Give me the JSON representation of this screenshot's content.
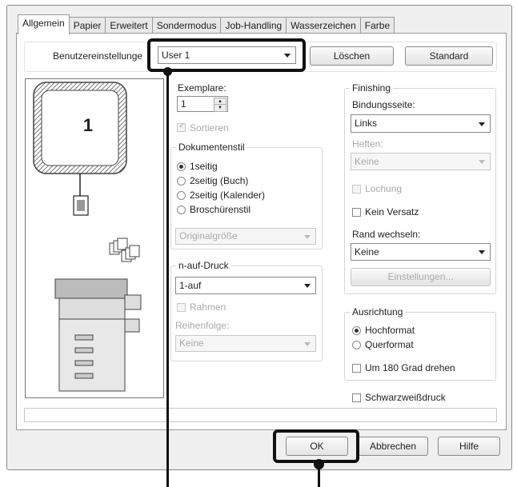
{
  "tabs": [
    "Allgemein",
    "Papier",
    "Erweitert",
    "Sondermodus",
    "Job-Handling",
    "Wasserzeichen",
    "Farbe"
  ],
  "user_settings": {
    "label": "Benutzereinstellunge",
    "value": "User 1",
    "delete_label": "Löschen",
    "default_label": "Standard"
  },
  "preview": {
    "page_number": "1"
  },
  "copies": {
    "label": "Exemplare:",
    "value": "1",
    "collate_label": "Sortieren"
  },
  "document_style": {
    "legend": "Dokumentenstil",
    "options": [
      "1seitig",
      "2seitig (Buch)",
      "2seitig (Kalender)",
      "Broschürenstil"
    ],
    "selected": "1seitig",
    "size_value": "Originalgröße"
  },
  "n_up": {
    "legend": "n-auf-Druck",
    "value": "1-auf",
    "border_label": "Rahmen",
    "order_label": "Reihenfolge:",
    "order_value": "Keine"
  },
  "finishing": {
    "legend": "Finishing",
    "binding_label": "Bindungsseite:",
    "binding_value": "Links",
    "staple_label": "Heften:",
    "staple_value": "Keine",
    "punch_label": "Lochung",
    "no_offset_label": "Kein Versatz",
    "margin_shift_label": "Rand wechseln:",
    "margin_shift_value": "Keine",
    "settings_label": "Einstellungen..."
  },
  "orientation": {
    "legend": "Ausrichtung",
    "options": [
      "Hochformat",
      "Querformat"
    ],
    "selected": "Hochformat",
    "rotate_label": "Um 180 Grad drehen"
  },
  "bw_label": "Schwarzweißdruck",
  "footer": {
    "ok": "OK",
    "cancel": "Abbrechen",
    "help": "Hilfe"
  }
}
